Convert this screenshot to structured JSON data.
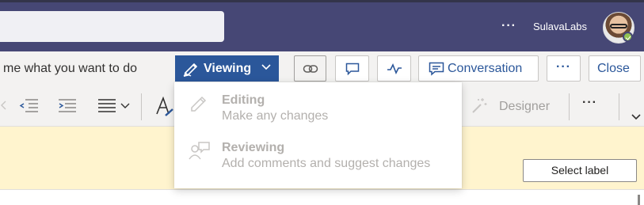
{
  "header": {
    "more_label": "···",
    "org_name": "SulavaLabs"
  },
  "commandbar": {
    "tell_me": "me what you want to do",
    "viewing_label": "Viewing",
    "conversation_label": "Conversation",
    "more_label": "···",
    "close_label": "Close"
  },
  "ribbon": {
    "designer_label": "Designer",
    "more_label": "···"
  },
  "mode_menu": {
    "items": [
      {
        "title": "Editing",
        "description": "Make any changes",
        "icon": "pencil-icon",
        "disabled": true
      },
      {
        "title": "Reviewing",
        "description": "Add comments and suggest changes",
        "icon": "reviewer-icon",
        "disabled": true
      }
    ]
  },
  "infobar": {
    "select_label": "Select label"
  },
  "colors": {
    "teams_header": "#464775",
    "word_blue": "#2b579a",
    "infobar_bg": "#fff4ce",
    "disabled_text": "#b3b0ad"
  }
}
